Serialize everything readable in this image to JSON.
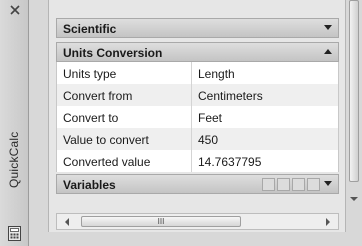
{
  "palette": {
    "title": "QuickCalc"
  },
  "sections": {
    "scientific": {
      "label": "Scientific"
    },
    "units_conversion": {
      "label": "Units Conversion"
    },
    "variables": {
      "label": "Variables"
    }
  },
  "units_table": {
    "rows": [
      {
        "label": "Units type",
        "value": "Length"
      },
      {
        "label": "Convert from",
        "value": "Centimeters"
      },
      {
        "label": "Convert to",
        "value": "Feet"
      },
      {
        "label": "Value to convert",
        "value": "450"
      },
      {
        "label": "Converted value",
        "value": "14.7637795"
      }
    ]
  },
  "scrollbar": {
    "thumb_grip": "III"
  },
  "icons": {
    "strip_close": "close-icon",
    "strip_calculator": "calculator-icon",
    "section_expand": "chevron-down-icon",
    "section_collapse": "chevron-up-icon",
    "variables_tools": [
      "new-variable-icon",
      "edit-variable-icon",
      "delete-variable-icon",
      "calculator-variable-icon"
    ]
  }
}
